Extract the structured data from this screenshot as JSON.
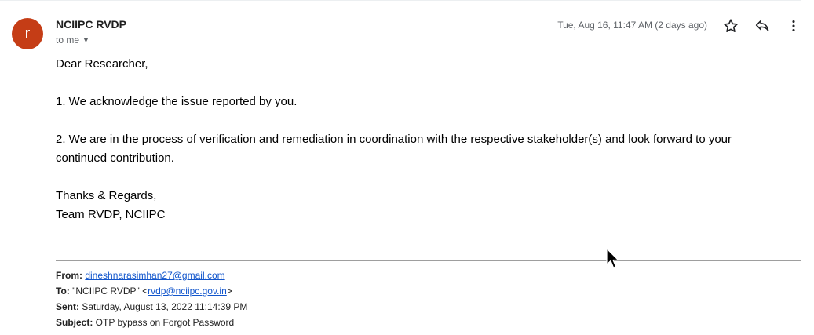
{
  "email": {
    "avatar_letter": "r",
    "sender_name": "NCIIPC RVDP",
    "recipient_label": "to me",
    "timestamp": "Tue, Aug 16, 11:47 AM (2 days ago)",
    "greeting": "Dear Researcher,",
    "paragraph_1": "1. We acknowledge the issue reported by you.",
    "paragraph_2_line_1": "2. We are in the process of verification and remediation in coordination with the respective stakeholder(s) and look forward to your",
    "paragraph_2_line_2": "continued contribution.",
    "signoff": "Thanks & Regards,",
    "signature": "Team RVDP, NCIIPC"
  },
  "quoted": {
    "from_label": "From:",
    "from_email": "dineshnarasimhan27@gmail.com",
    "to_label": "To:",
    "to_name": " \"NCIIPC RVDP\" <",
    "to_email": "rvdp@nciipc.gov.in",
    "to_close": ">",
    "sent_label": "Sent:",
    "sent_value": " Saturday, August 13, 2022 11:14:39 PM",
    "subject_label": "Subject:",
    "subject_value": " OTP bypass on Forgot Password"
  },
  "icons": {
    "star": "star-icon",
    "reply": "reply-icon",
    "more": "more-vert-icon",
    "expand": "chevron-down-icon",
    "cursor": "mouse-pointer-icon"
  },
  "colors": {
    "avatar": "#c53d16",
    "link": "#1155cc",
    "secondary_text": "#5f6368"
  }
}
